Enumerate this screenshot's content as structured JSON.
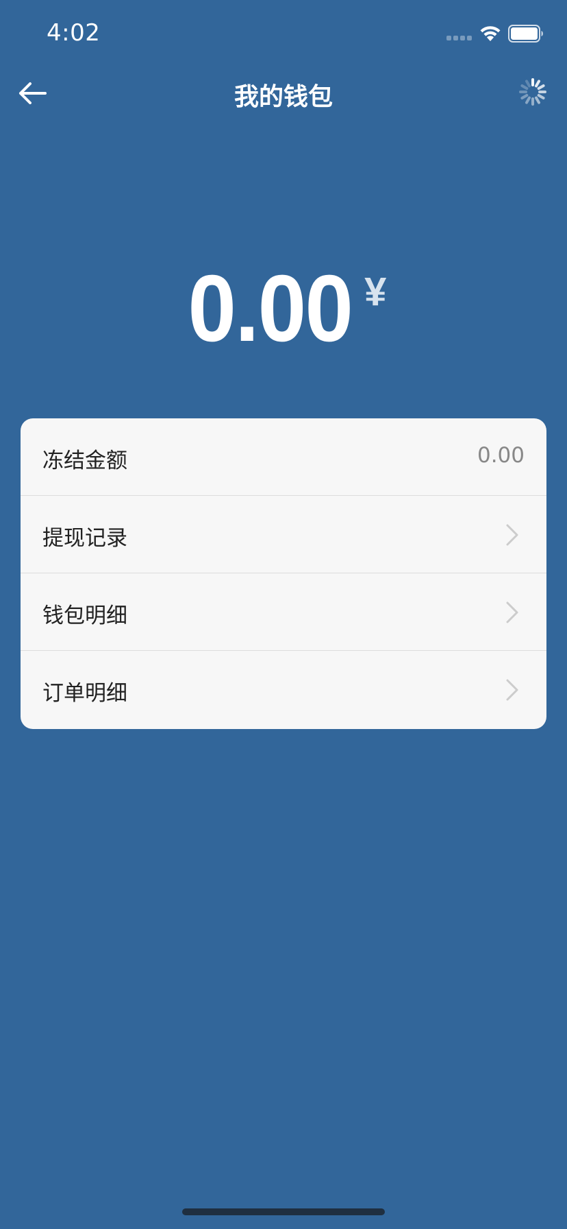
{
  "status_bar": {
    "time": "4:02",
    "signal_icon": "signal-dots-icon",
    "wifi_icon": "wifi-icon",
    "battery_icon": "battery-icon"
  },
  "nav": {
    "back_icon": "arrow-left-icon",
    "title": "我的钱包",
    "loading_icon": "spinner-icon"
  },
  "balance": {
    "amount": "0.00",
    "currency": "¥"
  },
  "menu": {
    "items": [
      {
        "label": "冻结金额",
        "value": "0.00",
        "has_chevron": false
      },
      {
        "label": "提现记录",
        "value": "",
        "has_chevron": true
      },
      {
        "label": "钱包明细",
        "value": "",
        "has_chevron": true
      },
      {
        "label": "订单明细",
        "value": "",
        "has_chevron": true
      }
    ]
  },
  "colors": {
    "background": "#32669a",
    "card": "#f7f7f7",
    "text_primary": "#222222",
    "text_secondary": "#888888",
    "chevron": "#cccccc"
  }
}
